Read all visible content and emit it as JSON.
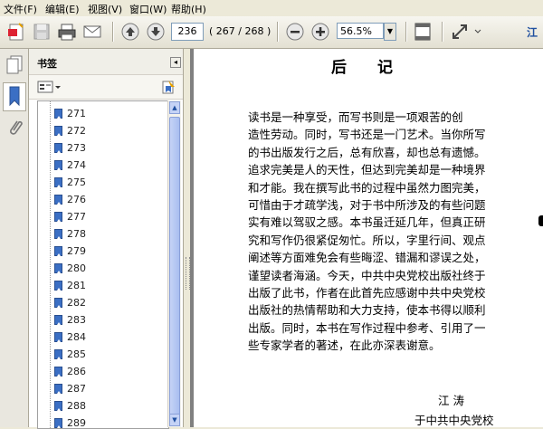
{
  "menu": [
    {
      "label": "文件(F)"
    },
    {
      "label": "编辑(E)"
    },
    {
      "label": "视图(V)"
    },
    {
      "label": "窗口(W)"
    },
    {
      "label": "帮助(H)"
    }
  ],
  "toolbar": {
    "current_page": "236",
    "page_count": "( 267 / 268 )",
    "zoom": "56.5%",
    "right_label": "江",
    "icons": [
      "create-pdf-icon",
      "save-icon",
      "print-icon",
      "email-icon",
      "prev-page-icon",
      "next-page-icon",
      "zoom-out-icon",
      "zoom-in-icon",
      "fit-page-icon",
      "fullscreen-icon"
    ]
  },
  "panel": {
    "title": "书签",
    "bookmarks": [
      "271",
      "272",
      "273",
      "274",
      "275",
      "276",
      "277",
      "278",
      "279",
      "280",
      "281",
      "282",
      "283",
      "284",
      "285",
      "286",
      "287",
      "288",
      "289"
    ]
  },
  "document": {
    "heading": "后  记",
    "lines": [
      "  读书是一种享受，而写书则是一项艰苦的创",
      "造性劳动。同时，写书还是一门艺术。当你所写",
      "的书出版发行之后，总有欣喜，却也总有遗憾。",
      "追求完美是人的天性，但达到完美却是一种境界",
      "和才能。我在撰写此书的过程中虽然力图完美，",
      "可惜由于才疏学浅，对于书中所涉及的有些问题",
      "实有难以驾驭之感。本书虽迁延几年，但真正研",
      "究和写作仍很紧促匆忙。所以，字里行间、观点",
      "阐述等方面难免会有些晦涩、错漏和谬误之处，",
      "谨望读者海涵。今天，中共中央党校出版社终于",
      "出版了此书，作者在此首先应感谢中共中央党校",
      "出版社的热情帮助和大力支持，使本书得以顺利",
      "出版。同时，本书在写作过程中参考、引用了一",
      "些专家学者的著述，在此亦深表谢意。"
    ],
    "signature": "江  涛",
    "signature_place": "于中共中央党校"
  }
}
